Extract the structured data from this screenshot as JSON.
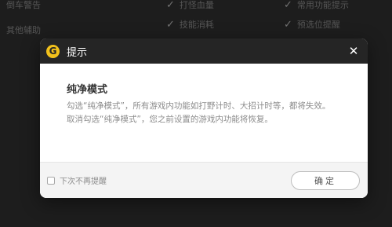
{
  "background": {
    "left_labels": [
      "倒车警告",
      "其他辅助"
    ],
    "options_col1": [
      "打怪血量",
      "技能消耗"
    ],
    "options_col2": [
      "常用功能提示",
      "预选位提醒"
    ]
  },
  "dialog": {
    "title": "提示",
    "logo_letter": "G",
    "close_glyph": "✕",
    "heading": "纯净模式",
    "paragraph1": "勾选“纯净模式”，所有游戏内功能如打野计时、大招计时等，都将失效。",
    "paragraph2": "取消勾选“纯净模式”，您之前设置的游戏内功能将恢复。",
    "dont_remind_label": "下次不再提醒",
    "dont_remind_checked": false,
    "confirm_label": "确定"
  },
  "colors": {
    "title_bar_bg": "#252525",
    "logo_accent": "#f2c11b"
  },
  "icons": {
    "logo": "app-logo-icon",
    "close": "close-icon",
    "check": "check-icon"
  }
}
